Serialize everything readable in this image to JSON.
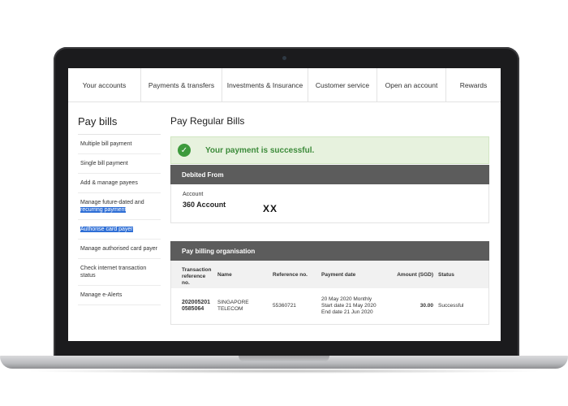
{
  "nav": {
    "items": [
      {
        "label": "Your accounts"
      },
      {
        "label": "Payments & transfers"
      },
      {
        "label": "Investments & Insurance"
      },
      {
        "label": "Customer service"
      },
      {
        "label": "Open an account"
      },
      {
        "label": "Rewards"
      }
    ]
  },
  "sidebar": {
    "title": "Pay bills",
    "items": [
      {
        "label": "Multiple bill payment"
      },
      {
        "label": "Single bill payment"
      },
      {
        "label": "Add & manage payees"
      },
      {
        "label": "Manage future-dated and",
        "label_hl": "recurring payment"
      },
      {
        "label_hl": "Authorise card payer"
      },
      {
        "label": "Manage authorised card payer"
      },
      {
        "label": "Check internet transaction status"
      },
      {
        "label": "Manage e-Alerts"
      }
    ]
  },
  "main": {
    "title": "Pay Regular Bills",
    "success_message": "Your payment is successful.",
    "debited": {
      "heading": "Debited From",
      "account_label": "Account",
      "account_name": "360 Account",
      "account_mask": "XX"
    },
    "billing": {
      "heading": "Pay billing organisation",
      "columns": {
        "ref_line1": "Transaction",
        "ref_line2": "reference",
        "ref_line3": "no.",
        "name": "Name",
        "reference": "Reference no.",
        "date": "Payment date",
        "amount": "Amount (SGD)",
        "status": "Status"
      },
      "row": {
        "ref_line1": "202005201",
        "ref_line2": "0585064",
        "name_line1": "SINGAPORE",
        "name_line2": "TELECOM",
        "reference": "55360721",
        "date_line1": "20 May 2020 Monthly",
        "date_line2": "Start date 21 May 2020",
        "date_line3": "End date 21 Jun 2020",
        "amount": "30.00",
        "status": "Successful"
      }
    }
  },
  "colors": {
    "header_bar": "#5c5c5c",
    "success_bg": "#e7f2de",
    "success_text": "#3c8b3a",
    "highlight": "#2f6fd6"
  }
}
